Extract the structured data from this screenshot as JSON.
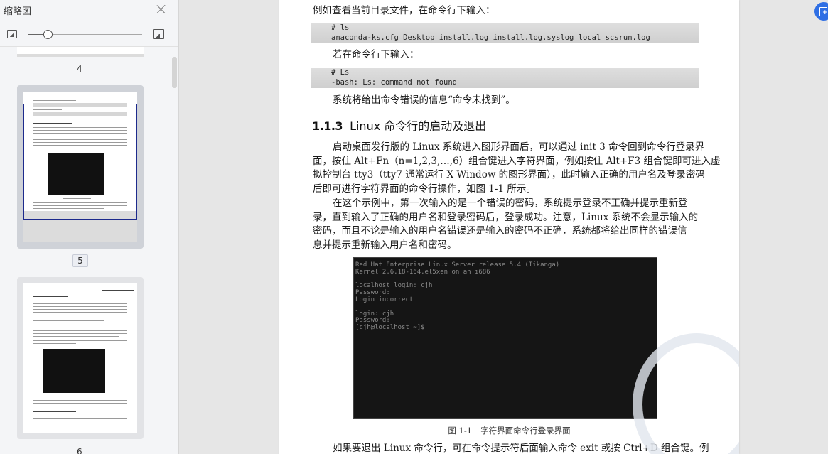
{
  "sidebar": {
    "title": "缩略图",
    "zoom_level": 0.17,
    "thumbnails": [
      {
        "page": "4",
        "active": false
      },
      {
        "page": "5",
        "active": true
      },
      {
        "page": "6",
        "active": false
      }
    ]
  },
  "document": {
    "lines_top": [
      "例如查看当前目录文件，在命令行下输入："
    ],
    "code1": [
      "# ls",
      "anaconda-ks.cfg  Desktop  install.log  install.log.syslog  local  scsrun.log"
    ],
    "line_after_code1": "若在命令行下输入：",
    "code2": [
      "# Ls",
      "-bash: Ls: command not found"
    ],
    "line_after_code2": "系统将给出命令错误的信息“命令未找到”。",
    "heading_num": "1.1.3",
    "heading_text": "Linux 命令行的启动及退出",
    "para1": [
      "启动桌面发行版的 Linux 系统进入图形界面后，可以通过 init 3 命令回到命令行登录界",
      "面，按住 Alt+Fn（n=1,2,3,…,6）组合键进入字符界面，例如按住 Alt+F3 组合键即可进入虚",
      "拟控制台 tty3（tty7 通常运行 X Window 的图形界面），此时输入正确的用户名及登录密码",
      "后即可进行字符界面的命令行操作，如图 1-1 所示。"
    ],
    "para2": [
      "在这个示例中，第一次输入的是一个错误的密码，系统提示登录不正确并提示重新登",
      "录，直到输入了正确的用户名和登录密码后，登录成功。注意，Linux 系统不会显示输入的",
      "密码，而且不论是输入的用户名错误还是输入的密码不正确，系统都将给出同样的错误信",
      "息并提示重新输入用户名和密码。"
    ],
    "terminal": [
      "Red Hat Enterprise Linux Server release 5.4 (Tikanga)",
      "Kernel 2.6.18-164.el5xen on an i686",
      "",
      "localhost login: cjh",
      "Password:",
      "Login incorrect",
      "",
      "login: cjh",
      "Password:",
      "[cjh@localhost ~]$ _"
    ],
    "caption_num": "图 1-1",
    "caption_text": "字符界面命令行登录界面",
    "line_bottom": "如果要退出 Linux 命令行，可在命令提示符后面输入命令 exit 或按 Ctrl+D 组合键。例"
  },
  "colors": {
    "accent": "#2f6fe4",
    "sidebar_bg": "#f4f5f7",
    "canvas_bg": "#e6e6e6",
    "selected_thumb": "#cfd2d8"
  }
}
